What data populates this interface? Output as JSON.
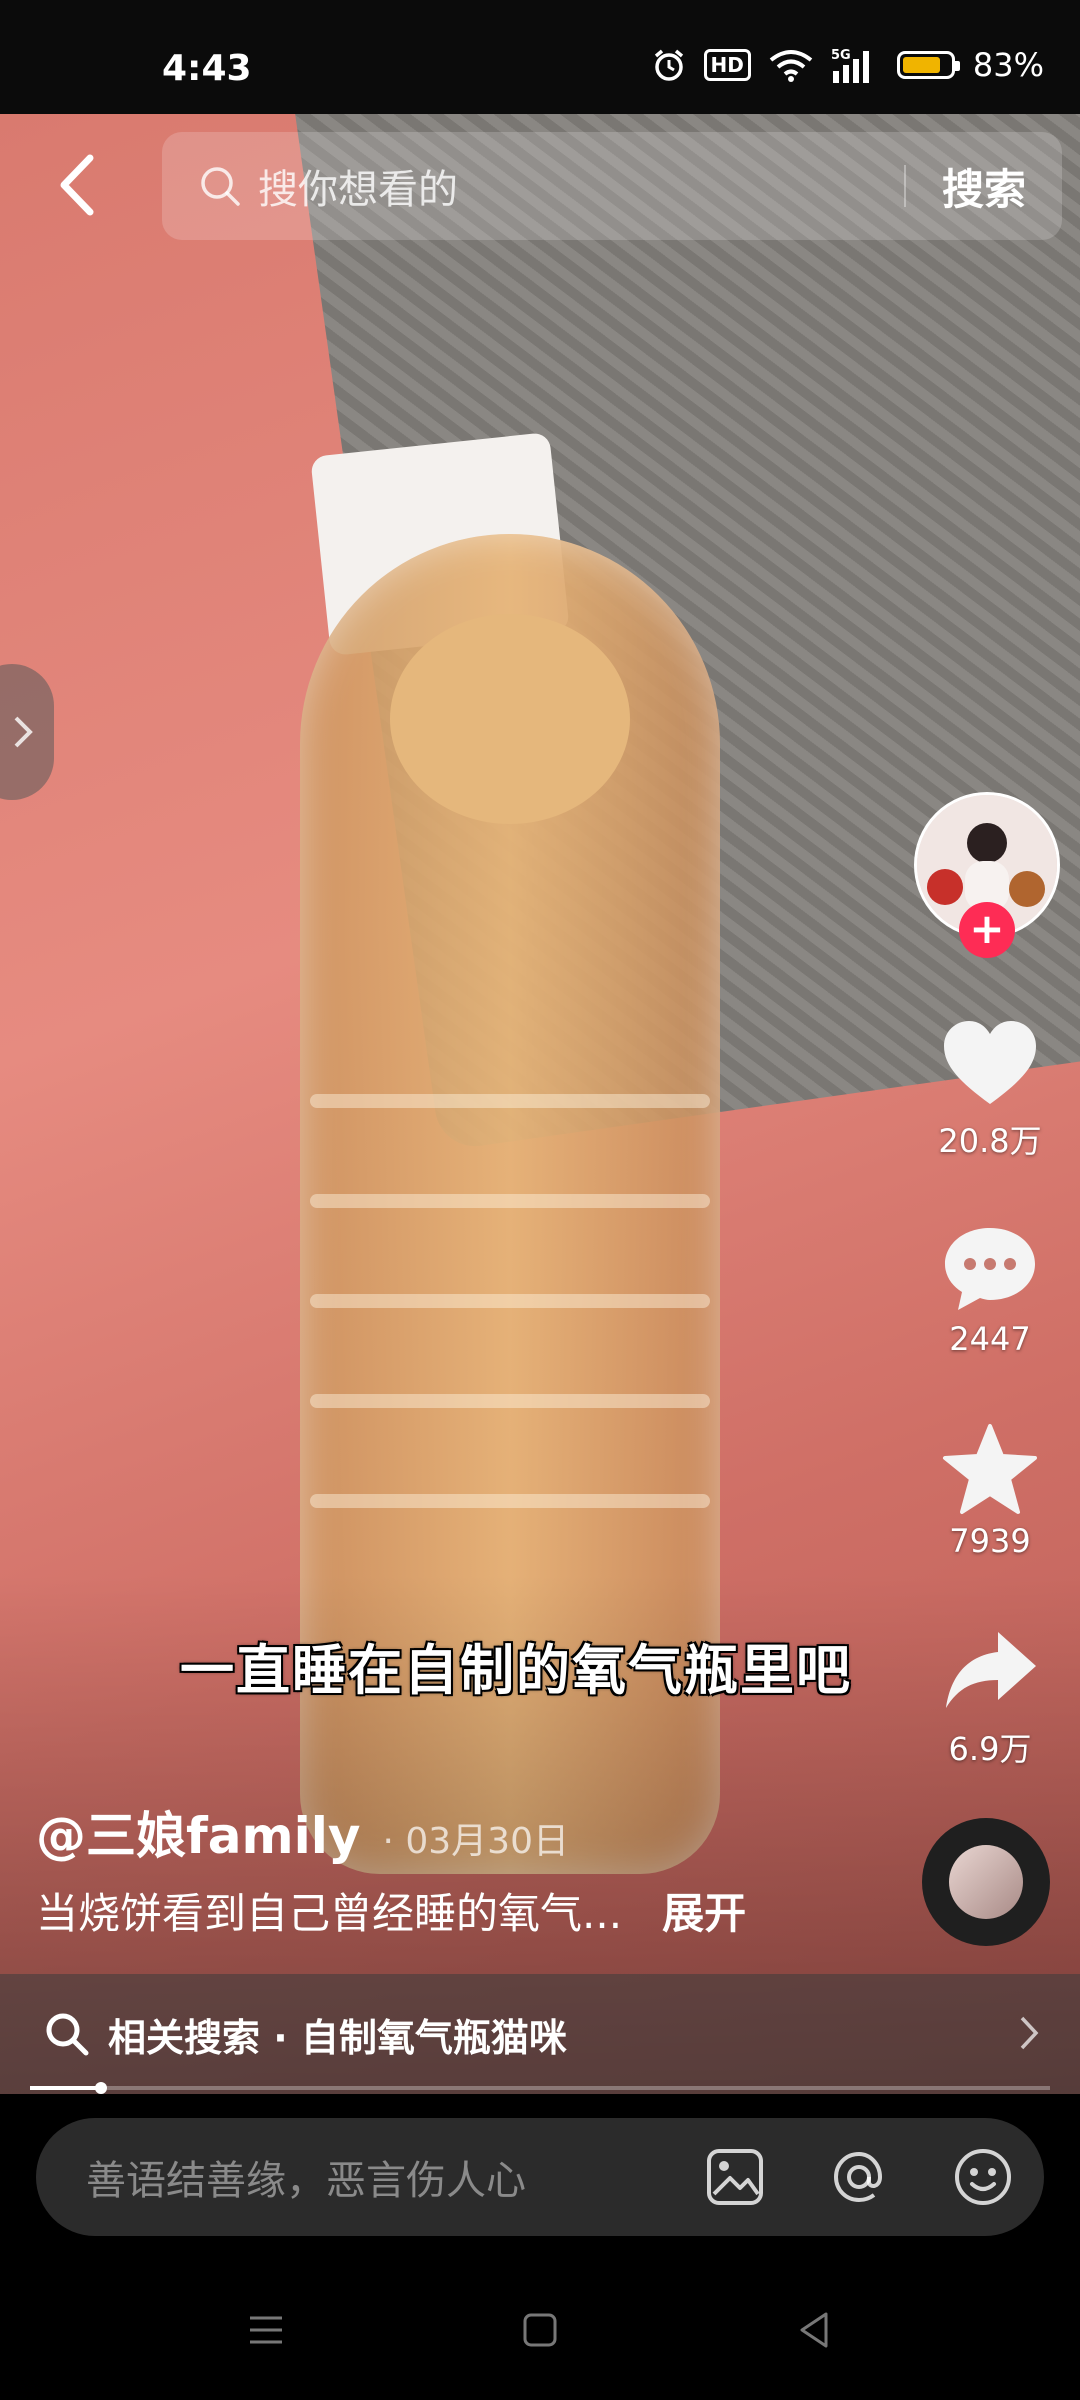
{
  "status_bar": {
    "time": "4:43",
    "icons": [
      "alarm-icon",
      "hd-icon",
      "wifi-icon",
      "5g-signal-icon",
      "battery-icon"
    ],
    "hd_label": "HD",
    "battery_percent": "83%",
    "battery_level": 0.83,
    "battery_color": "#f0b400"
  },
  "search": {
    "placeholder": "搜你想看的",
    "button_label": "搜索"
  },
  "video": {
    "subtitle": "一直睡在自制的氧气瓶里吧",
    "author": "@三娘family",
    "date": "· 03月30日",
    "caption": "当烧饼看到自己曾经睡的氧气...",
    "expand_label": "展开",
    "progress": 0.07
  },
  "actions": {
    "likes": "20.8万",
    "comments": "2447",
    "favorites": "7939",
    "shares": "6.9万",
    "follow_symbol": "+",
    "accent_color": "#fe2c55"
  },
  "related_search": {
    "label": "相关搜索 · 自制氧气瓶猫咪"
  },
  "comment_bar": {
    "placeholder": "善语结善缘，恶言伤人心",
    "icons": [
      "image-icon",
      "at-icon",
      "emoji-icon"
    ]
  },
  "nav_bar": {
    "icons": [
      "menu-icon",
      "home-icon",
      "back-icon"
    ]
  }
}
